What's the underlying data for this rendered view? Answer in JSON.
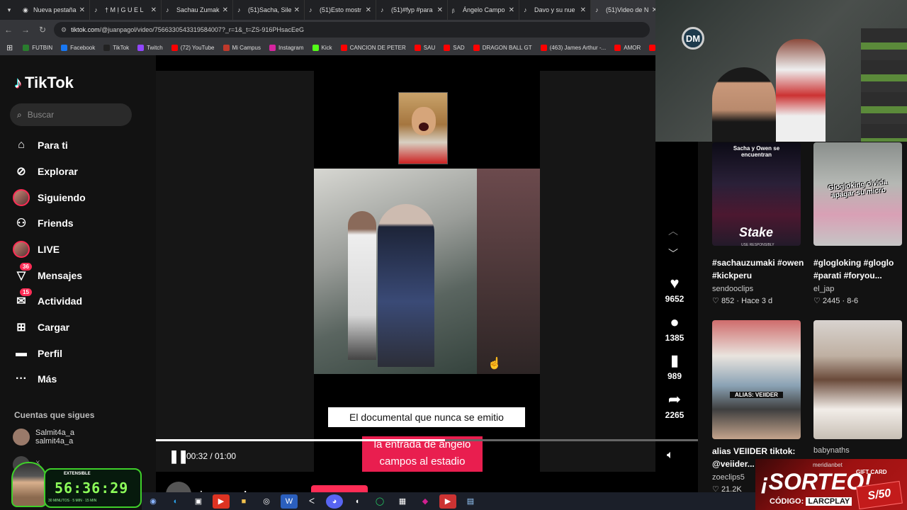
{
  "browser": {
    "tab_menu_icon": "chevron-down-icon",
    "tabs": [
      {
        "label": "Nueva pestaña",
        "icon": "chrome-icon"
      },
      {
        "label": "† M Ị G U E L",
        "icon": "tiktok-icon"
      },
      {
        "label": "Sachau Zumaki",
        "icon": "tiktok-icon"
      },
      {
        "label": "(51)Sacha, Silen",
        "icon": "tiktok-icon"
      },
      {
        "label": "(51)Esto mostr",
        "icon": "tiktok-icon"
      },
      {
        "label": "(51)#fyp #para",
        "icon": "tiktok-icon"
      },
      {
        "label": "Ángelo Campo",
        "icon": "bing-icon"
      },
      {
        "label": "Davo y su nue",
        "icon": "tiktok-icon"
      },
      {
        "label": "(51)Video de N",
        "icon": "tiktok-icon"
      }
    ],
    "url_host": "tiktok.com",
    "url_path": "/@juanpagol/video/7566330543319584007?_r=1&_t=ZS-916PHsacEeG",
    "bookmarks": [
      {
        "label": "FUTBIN",
        "color": "#2a7d2e"
      },
      {
        "label": "Facebook",
        "color": "#1877f2"
      },
      {
        "label": "TikTok",
        "color": "#222222"
      },
      {
        "label": "Twitch",
        "color": "#9146ff"
      },
      {
        "label": "(72) YouTube",
        "color": "#ff0000"
      },
      {
        "label": "Mi Campus",
        "color": "#c0392b"
      },
      {
        "label": "Instagram",
        "color": "#d6249f"
      },
      {
        "label": "Kick",
        "color": "#53fc18"
      },
      {
        "label": "CANCION DE PETER",
        "color": "#ff0000"
      },
      {
        "label": "SAU",
        "color": "#ff0000"
      },
      {
        "label": "SAD",
        "color": "#ff0000"
      },
      {
        "label": "DRAGON BALL GT",
        "color": "#ff0000"
      },
      {
        "label": "(463) James Arthur -...",
        "color": "#ff0000"
      },
      {
        "label": "AMOR",
        "color": "#ff0000"
      },
      {
        "label": "(2",
        "color": "#ff0000"
      }
    ]
  },
  "sidebar": {
    "logo": "TikTok",
    "search_placeholder": "Buscar",
    "items": [
      {
        "label": "Para ti",
        "icon": "home-icon"
      },
      {
        "label": "Explorar",
        "icon": "compass-icon"
      },
      {
        "label": "Siguiendo",
        "icon": "avatar-icon"
      },
      {
        "label": "Friends",
        "icon": "friends-icon"
      },
      {
        "label": "LIVE",
        "icon": "live-icon"
      },
      {
        "label": "Mensajes",
        "icon": "messages-icon",
        "badge": "36"
      },
      {
        "label": "Actividad",
        "icon": "activity-icon",
        "badge": "15"
      },
      {
        "label": "Cargar",
        "icon": "upload-icon"
      },
      {
        "label": "Perfil",
        "icon": "profile-icon"
      },
      {
        "label": "Más",
        "icon": "more-icon"
      }
    ],
    "following_title": "Cuentas que sigues",
    "following": [
      {
        "name": "Salmit4a_a",
        "handle": "salmit4a_a"
      },
      {
        "name": "ᛝ",
        "handle": ""
      }
    ]
  },
  "video": {
    "caption_top": "El documental que nunca se emitio",
    "caption_bottom": "la entrada de angelo campos al estadio",
    "time": "00:32 / 01:00",
    "progress": 0.533,
    "author": "juanpagol"
  },
  "actions": [
    {
      "icon": "heart-icon",
      "count": "9652"
    },
    {
      "icon": "comment-icon",
      "count": "1385"
    },
    {
      "icon": "bookmark-icon",
      "count": "989"
    },
    {
      "icon": "share-icon",
      "count": "2265"
    }
  ],
  "recommendations": [
    {
      "title": "#sachauzumaki #owen #kickperu",
      "user": "sendooclips",
      "likes": "852",
      "date": "Hace 3 d",
      "overlay": "Sacha y Owen se encuentran"
    },
    {
      "title": "#glogloking #gloglo #parati #foryou...",
      "user": "el_jap",
      "likes": "2445",
      "date": "8-6",
      "overlay": "Glogloking olvida apagar su micro"
    },
    {
      "title": "alias VEIIDER tiktok: @veiider...",
      "user": "zoeclips5",
      "likes": "21.2K",
      "date": "",
      "overlay": "ALIAS: VEIIDER"
    },
    {
      "title": "",
      "user": "babynaths",
      "likes": "",
      "date": "",
      "overlay": ""
    }
  ],
  "stake": {
    "logo": "Stake",
    "sub": "USE RESPONSIBLY"
  },
  "sorteo": {
    "brand": "meridianbet",
    "title": "¡SORTEO!",
    "code_label": "CÓDIGO:",
    "code": "LARCPLAY",
    "gift": "GIFT CARD",
    "amount": "S/50"
  },
  "timer": {
    "label": "EXTENSIBLE",
    "value": "56:36:29",
    "sub": "30 MINUTOS · 5 MIN · 15 MIN"
  },
  "webcam_logo": "DM"
}
